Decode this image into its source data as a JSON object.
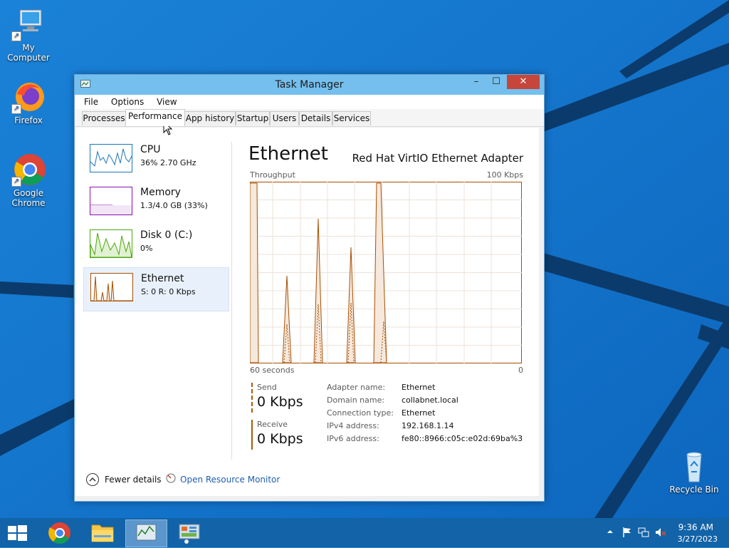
{
  "desktop": {
    "icons": [
      {
        "label": "My Computer"
      },
      {
        "label": "Firefox"
      },
      {
        "label": "Google\nChrome"
      },
      {
        "label": "Recycle Bin"
      }
    ]
  },
  "window": {
    "title": "Task Manager",
    "controls": {
      "minimize": "–",
      "maximize": "☐",
      "close": "✕"
    },
    "menu": [
      "File",
      "Options",
      "View"
    ],
    "tabs": [
      "Processes",
      "Performance",
      "App history",
      "Startup",
      "Users",
      "Details",
      "Services"
    ],
    "active_tab": "Performance"
  },
  "sidebar": {
    "items": [
      {
        "name": "CPU",
        "value": "36%  2.70 GHz",
        "color": "#1a76b9"
      },
      {
        "name": "Memory",
        "value": "1.3/4.0 GB (33%)",
        "color": "#8b12ae"
      },
      {
        "name": "Disk 0 (C:)",
        "value": "0%",
        "color": "#4da60c"
      },
      {
        "name": "Ethernet",
        "value": "S: 0  R: 0 Kbps",
        "color": "#a74f01"
      }
    ]
  },
  "detail": {
    "title": "Ethernet",
    "adapter": "Red Hat VirtIO Ethernet Adapter",
    "throughput_label": "Throughput",
    "max_label": "100 Kbps",
    "seconds_label": "60 seconds",
    "zero_label": "0",
    "send": {
      "label": "Send",
      "value": "0 Kbps"
    },
    "receive": {
      "label": "Receive",
      "value": "0 Kbps"
    },
    "properties": [
      {
        "key": "Adapter name:",
        "value": "Ethernet"
      },
      {
        "key": "Domain name:",
        "value": "collabnet.local"
      },
      {
        "key": "Connection type:",
        "value": "Ethernet"
      },
      {
        "key": "IPv4 address:",
        "value": "192.168.1.14"
      },
      {
        "key": "IPv6 address:",
        "value": "fe80::8966:c05c:e02d:69ba%3"
      }
    ],
    "graph_color": "#a74f01"
  },
  "footer": {
    "fewer_details": "Fewer details",
    "resource_monitor": "Open Resource Monitor"
  },
  "taskbar": {
    "time": "9:36 AM",
    "date": "3/27/2023",
    "accent": "#1263a8"
  }
}
